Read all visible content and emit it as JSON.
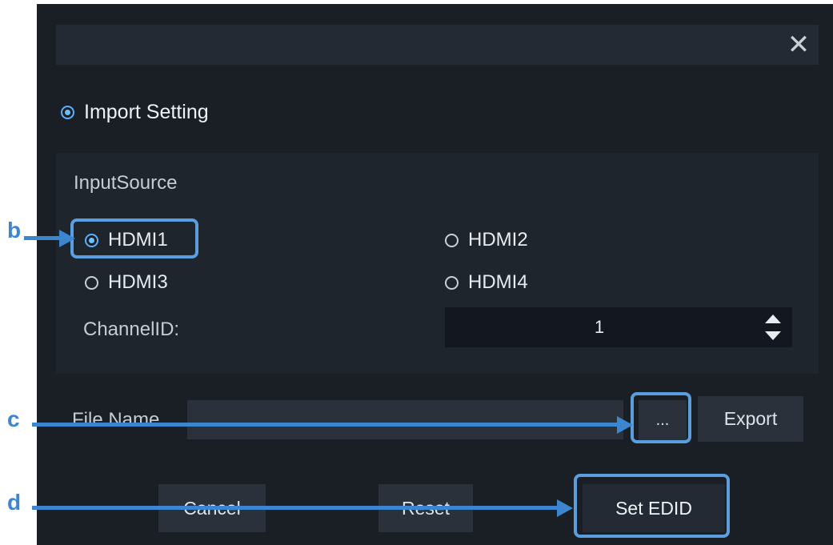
{
  "dialog": {
    "close_glyph": "✕",
    "import_setting_label": "Import Setting",
    "input_source": {
      "title": "InputSource",
      "options": [
        "HDMI1",
        "HDMI2",
        "HDMI3",
        "HDMI4"
      ],
      "selected": "HDMI1"
    },
    "channel": {
      "label": "ChannelID:",
      "value": "1"
    },
    "file": {
      "label": "File Name",
      "value": "",
      "browse_label": "...",
      "export_label": "Export"
    },
    "buttons": {
      "cancel": "Cancel",
      "reset": "Reset",
      "set_edid": "Set EDID"
    }
  },
  "annotations": {
    "b": "b",
    "c": "c",
    "d": "d",
    "color": "#3b86cf"
  }
}
